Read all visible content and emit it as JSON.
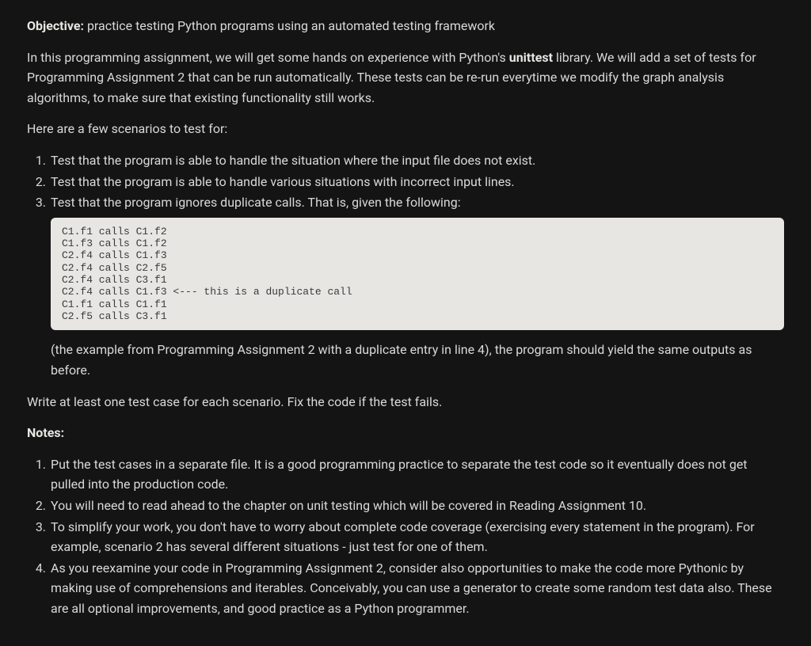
{
  "objective": {
    "label": "Objective:",
    "text": "practice testing Python programs using an automated testing framework"
  },
  "intro": {
    "part1": "In this programming assignment, we will get some hands on experience with Python's ",
    "bold": "unittest",
    "part2": " library. We will add a set of tests for Programming Assignment 2 that can be run automatically. These tests can be re-run everytime we modify the graph analysis algorithms, to make sure that existing functionality still works."
  },
  "scenario_intro": "Here are a few scenarios to test for:",
  "scenarios": [
    "Test that the program is able to handle the situation where the input file does not exist.",
    "Test that the program is able to handle various situations with incorrect input lines.",
    "Test that the program ignores duplicate calls. That is, given the following:"
  ],
  "code_block": "C1.f1 calls C1.f2\nC1.f3 calls C1.f2\nC2.f4 calls C1.f3\nC2.f4 calls C2.f5\nC2.f4 calls C3.f1\nC2.f4 calls C1.f3 <--- this is a duplicate call\nC1.f1 calls C1.f1\nC2.f5 calls C3.f1",
  "after_code": "(the example from Programming Assignment 2 with a duplicate entry in line 4), the program should yield the same outputs as before.",
  "write_line": "Write at least one test case for each scenario. Fix the code if the test fails.",
  "notes_label": "Notes:",
  "notes": [
    "Put the test cases in a separate file. It is a good programming practice to separate the test code so it eventually does not get pulled into the production code.",
    "You will need to read ahead to the chapter on unit testing which will be covered in Reading Assignment 10.",
    "To simplify your work, you don't have to worry about complete code coverage (exercising every statement in the program). For example, scenario 2 has several different situations - just test for one of them.",
    "As you reexamine your code in Programming Assignment 2, consider also opportunities to make the code more Pythonic by making use of comprehensions and iterables. Conceivably, you can use a generator to create some random test data also. These are all optional improvements, and good practice as a Python programmer."
  ]
}
